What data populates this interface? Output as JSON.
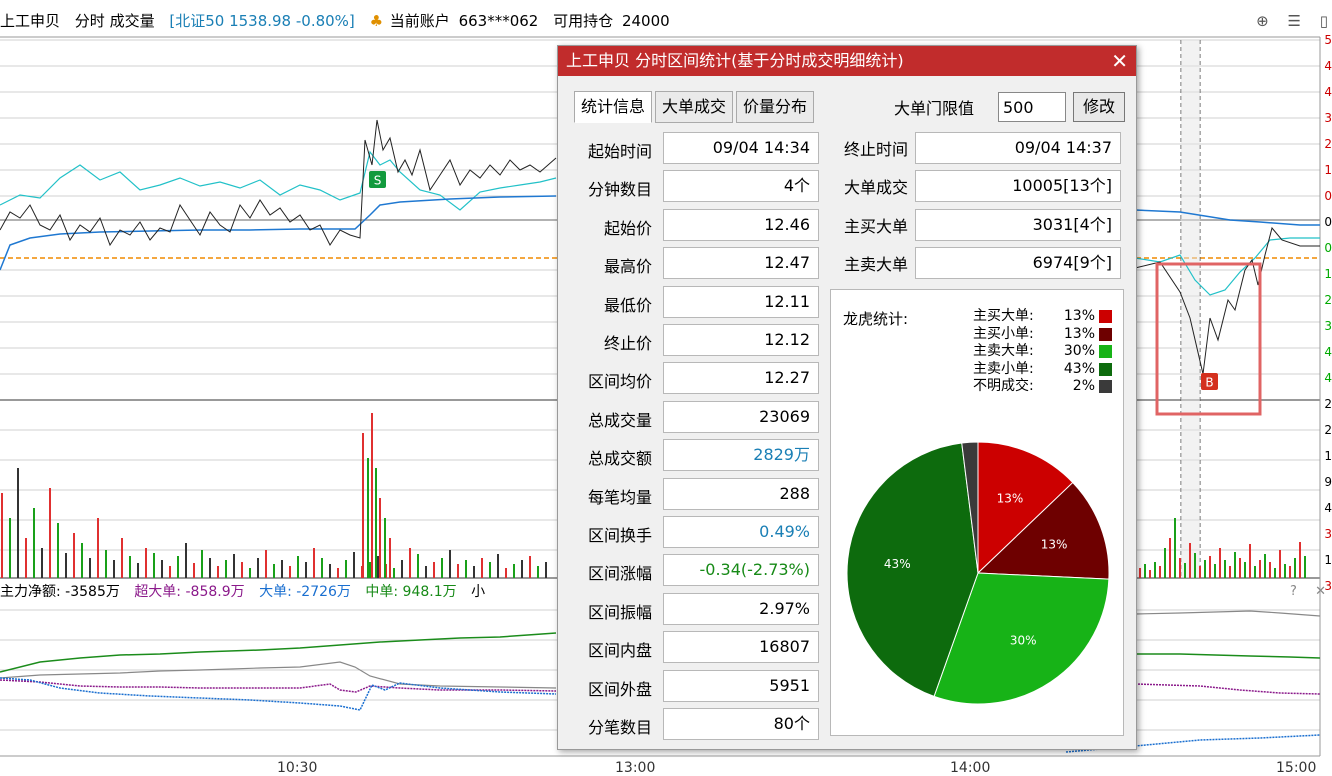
{
  "header": {
    "stock_name": "上工申贝",
    "view_label": "分时 成交量",
    "index_info": "[北证50 1538.98 -0.80%]",
    "account_label": "当前账户",
    "account_id": "663***062",
    "holding_label": "可用持仓",
    "holding_value": "24000"
  },
  "indicator_bar": {
    "main_net": "主力净额: -3585万",
    "super_large": "超大单: -858.9万",
    "large": "大单: -2726万",
    "medium": "中单: 948.1万",
    "small": "小"
  },
  "time_axis": [
    "10:30",
    "13:00",
    "14:00",
    "15:00"
  ],
  "markers": {
    "sell": "S",
    "buy": "B"
  },
  "right_axis_digits": [
    "5",
    "4",
    "4",
    "3",
    "2",
    "1",
    "0",
    "0",
    "0",
    "1",
    "2",
    "3",
    "4",
    "4",
    "2",
    "2",
    "1",
    "9",
    "4",
    "3",
    "1",
    "3"
  ],
  "dialog": {
    "title": "上工申贝 分时区间统计(基于分时成交明细统计)",
    "close": "✕",
    "tabs": [
      "统计信息",
      "大单成交",
      "价量分布"
    ],
    "threshold_label": "大单门限值",
    "threshold_value": "500",
    "modify_button": "修改",
    "left_rows": [
      {
        "label": "起始时间",
        "value": "09/04 14:34",
        "color": "#000000"
      },
      {
        "label": "分钟数目",
        "value": "4个",
        "color": "#000000"
      },
      {
        "label": "起始价",
        "value": "12.46",
        "color": "#000000"
      },
      {
        "label": "最高价",
        "value": "12.47",
        "color": "#000000"
      },
      {
        "label": "最低价",
        "value": "12.11",
        "color": "#000000"
      },
      {
        "label": "终止价",
        "value": "12.12",
        "color": "#000000"
      },
      {
        "label": "区间均价",
        "value": "12.27",
        "color": "#000000"
      },
      {
        "label": "总成交量",
        "value": "23069",
        "color": "#000000"
      },
      {
        "label": "总成交额",
        "value": "2829万",
        "color": "#1a7fb5"
      },
      {
        "label": "每笔均量",
        "value": "288",
        "color": "#000000"
      },
      {
        "label": "区间换手",
        "value": "0.49%",
        "color": "#1a7fb5"
      },
      {
        "label": "区间涨幅",
        "value": "-0.34(-2.73%)",
        "color": "#178a17"
      },
      {
        "label": "区间振幅",
        "value": "2.97%",
        "color": "#000000"
      },
      {
        "label": "区间内盘",
        "value": "16807",
        "color": "#000000"
      },
      {
        "label": "区间外盘",
        "value": "5951",
        "color": "#000000"
      },
      {
        "label": "分笔数目",
        "value": "80个",
        "color": "#000000"
      }
    ],
    "right_rows": [
      {
        "label": "终止时间",
        "value": "09/04 14:37"
      },
      {
        "label": "大单成交",
        "value": "10005[13个]"
      },
      {
        "label": "主买大单",
        "value": "3031[4个]"
      },
      {
        "label": "主卖大单",
        "value": "6974[9个]"
      }
    ],
    "dragon_tiger_title": "龙虎统计:",
    "pie": [
      {
        "name": "主买大单:",
        "pct": "13%",
        "value": 13,
        "color": "#cc0000"
      },
      {
        "name": "主买小单:",
        "pct": "13%",
        "value": 13,
        "color": "#6e0000"
      },
      {
        "name": "主卖大单:",
        "pct": "30%",
        "value": 30,
        "color": "#17b317"
      },
      {
        "name": "主卖小单:",
        "pct": "43%",
        "value": 43,
        "color": "#0d6b0d"
      },
      {
        "name": "不明成交:",
        "pct": "2%",
        "value": 2,
        "color": "#3a3a3a"
      }
    ]
  }
}
